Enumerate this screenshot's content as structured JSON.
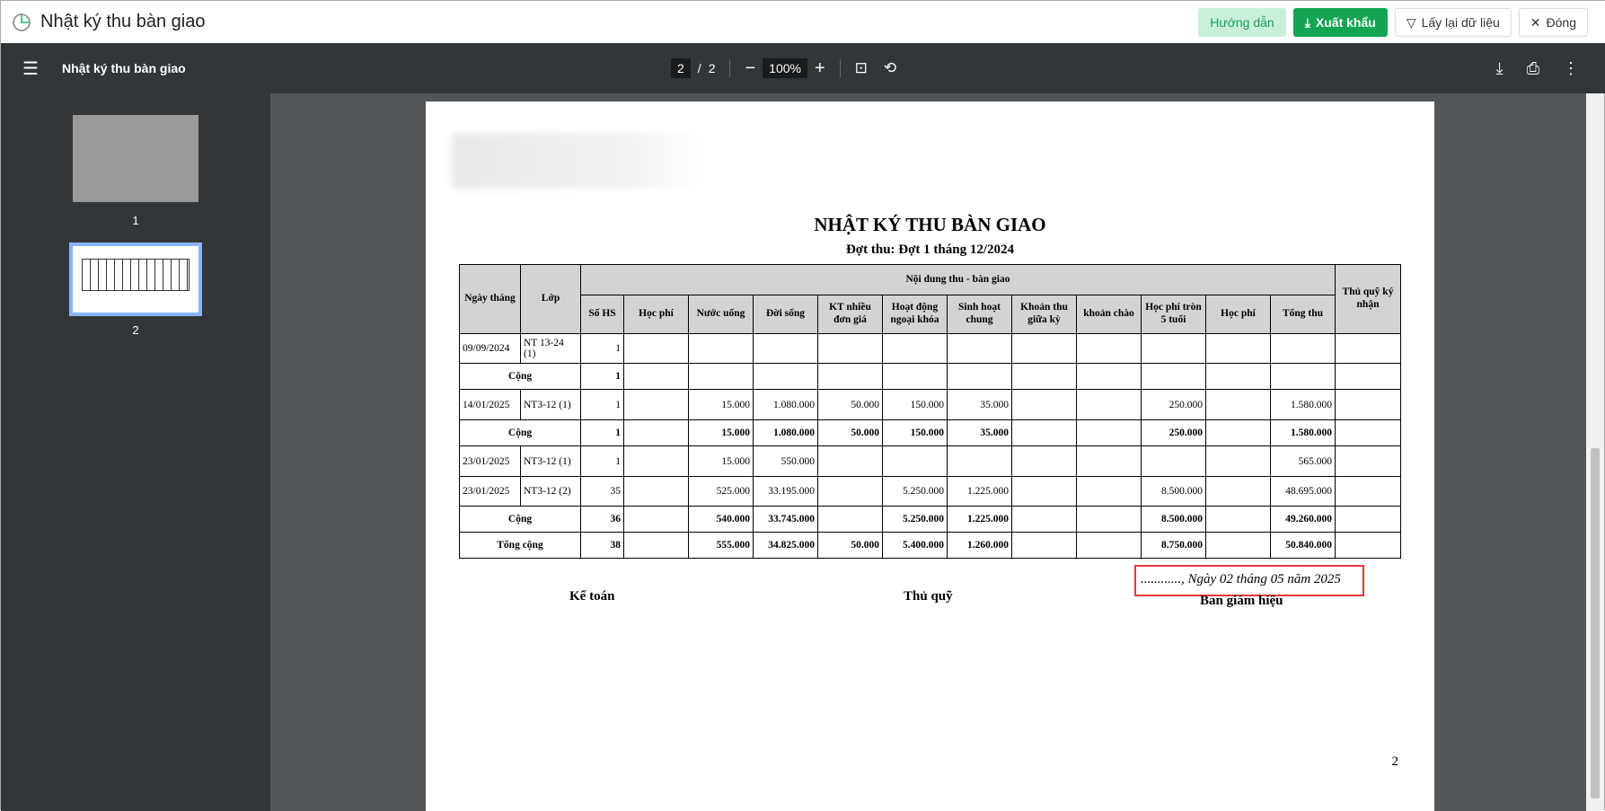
{
  "app": {
    "title": "Nhật ký thu bàn giao",
    "buttons": {
      "help": "Hướng dẫn",
      "export": "Xuất khẩu",
      "reload": "Lấy lại dữ liệu",
      "close": "Đóng"
    }
  },
  "viewer": {
    "doc_title": "Nhật ký thu bàn giao",
    "current_page": "2",
    "total_pages": "2",
    "zoom": "100%",
    "thumbs": [
      "1",
      "2"
    ]
  },
  "report": {
    "title": "NHẬT KÝ THU BÀN GIAO",
    "subtitle": "Đợt thu: Đợt 1 tháng 12/2024",
    "header": {
      "date": "Ngày tháng",
      "class": "Lớp",
      "group": "Nội dung thu - bàn giao",
      "signer": "Thủ quỹ ký nhận",
      "cols": [
        "Số HS",
        "Học phí",
        "Nước uống",
        "Đời sống",
        "KT nhiều đơn giá",
        "Hoạt động ngoại khóa",
        "Sinh hoạt chung",
        "Khoản thu giữa kỳ",
        "khoản chào",
        "Học phí tròn 5 tuổi",
        "Học phí",
        "Tổng thu"
      ]
    },
    "rows": [
      {
        "type": "row",
        "date": "09/09/2024",
        "class": "NT 13-24 (1)",
        "values": [
          "1",
          "",
          "",
          "",
          "",
          "",
          "",
          "",
          "",
          "",
          "",
          ""
        ]
      },
      {
        "type": "sum",
        "label": "Cộng",
        "values": [
          "1",
          "",
          "",
          "",
          "",
          "",
          "",
          "",
          "",
          "",
          "",
          ""
        ]
      },
      {
        "type": "row",
        "date": "14/01/2025",
        "class": "NT3-12 (1)",
        "values": [
          "1",
          "",
          "15.000",
          "1.080.000",
          "50.000",
          "150.000",
          "35.000",
          "",
          "",
          "250.000",
          "",
          "1.580.000"
        ]
      },
      {
        "type": "sum",
        "label": "Cộng",
        "values": [
          "1",
          "",
          "15.000",
          "1.080.000",
          "50.000",
          "150.000",
          "35.000",
          "",
          "",
          "250.000",
          "",
          "1.580.000"
        ]
      },
      {
        "type": "row",
        "date": "23/01/2025",
        "class": "NT3-12 (1)",
        "values": [
          "1",
          "",
          "15.000",
          "550.000",
          "",
          "",
          "",
          "",
          "",
          "",
          "",
          "565.000"
        ]
      },
      {
        "type": "row",
        "date": "23/01/2025",
        "class": "NT3-12 (2)",
        "values": [
          "35",
          "",
          "525.000",
          "33.195.000",
          "",
          "5.250.000",
          "1.225.000",
          "",
          "",
          "8.500.000",
          "",
          "48.695.000"
        ]
      },
      {
        "type": "sum",
        "label": "Cộng",
        "values": [
          "36",
          "",
          "540.000",
          "33.745.000",
          "",
          "5.250.000",
          "1.225.000",
          "",
          "",
          "8.500.000",
          "",
          "49.260.000"
        ]
      },
      {
        "type": "sum",
        "label": "Tổng cộng",
        "values": [
          "38",
          "",
          "555.000",
          "34.825.000",
          "50.000",
          "5.400.000",
          "1.260.000",
          "",
          "",
          "8.750.000",
          "",
          "50.840.000"
        ]
      }
    ],
    "date_line": "............, Ngày 02 tháng 05 năm 2025",
    "signatures": [
      "Kế toán",
      "Thủ quỹ",
      "Ban giám hiệu"
    ],
    "page_number": "2"
  }
}
